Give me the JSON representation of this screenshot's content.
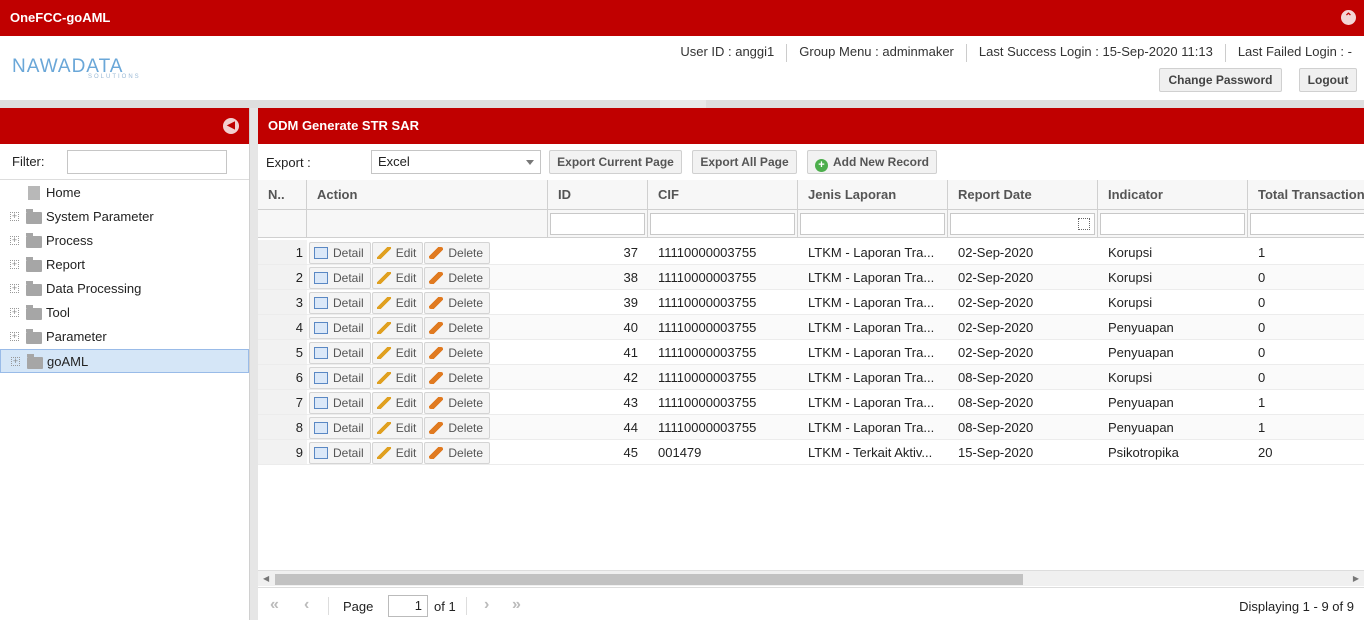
{
  "app": {
    "title": "OneFCC-goAML",
    "collapse_icon": "chevron-up-circle-icon"
  },
  "header": {
    "logo_main": "NAWADATA",
    "logo_sub": "SOLUTIONS",
    "user_id": "User ID : anggi1",
    "group_menu": "Group Menu : adminmaker",
    "last_success": "Last Success Login : 15-Sep-2020 11:13",
    "last_failed": "Last Failed Login : -",
    "change_password": "Change Password",
    "logout": "Logout"
  },
  "sidebar": {
    "filter_label": "Filter:",
    "filter_value": "",
    "items": [
      {
        "label": "Home",
        "type": "leaf"
      },
      {
        "label": "System Parameter",
        "type": "folder"
      },
      {
        "label": "Process",
        "type": "folder"
      },
      {
        "label": "Report",
        "type": "folder"
      },
      {
        "label": "Data Processing",
        "type": "folder"
      },
      {
        "label": "Tool",
        "type": "folder"
      },
      {
        "label": "Parameter",
        "type": "folder"
      },
      {
        "label": "goAML",
        "type": "folder",
        "selected": true
      }
    ]
  },
  "main": {
    "title": "ODM Generate STR SAR",
    "export_label": "Export :",
    "export_value": "Excel",
    "export_current": "Export Current Page",
    "export_all": "Export All Page",
    "add_new": "Add New Record",
    "columns": [
      "N..",
      "Action",
      "ID",
      "CIF",
      "Jenis Laporan",
      "Report Date",
      "Indicator",
      "Total Transaction"
    ],
    "action_labels": {
      "detail": "Detail",
      "edit": "Edit",
      "delete": "Delete"
    },
    "rows": [
      {
        "n": "1",
        "id": "37",
        "cif": "11110000003755",
        "jenis": "LTKM - Laporan Tra...",
        "date": "02-Sep-2020",
        "indicator": "Korupsi",
        "total": "1"
      },
      {
        "n": "2",
        "id": "38",
        "cif": "11110000003755",
        "jenis": "LTKM - Laporan Tra...",
        "date": "02-Sep-2020",
        "indicator": "Korupsi",
        "total": "0"
      },
      {
        "n": "3",
        "id": "39",
        "cif": "11110000003755",
        "jenis": "LTKM - Laporan Tra...",
        "date": "02-Sep-2020",
        "indicator": "Korupsi",
        "total": "0"
      },
      {
        "n": "4",
        "id": "40",
        "cif": "11110000003755",
        "jenis": "LTKM - Laporan Tra...",
        "date": "02-Sep-2020",
        "indicator": "Penyuapan",
        "total": "0"
      },
      {
        "n": "5",
        "id": "41",
        "cif": "11110000003755",
        "jenis": "LTKM - Laporan Tra...",
        "date": "02-Sep-2020",
        "indicator": "Penyuapan",
        "total": "0"
      },
      {
        "n": "6",
        "id": "42",
        "cif": "11110000003755",
        "jenis": "LTKM - Laporan Tra...",
        "date": "08-Sep-2020",
        "indicator": "Korupsi",
        "total": "0"
      },
      {
        "n": "7",
        "id": "43",
        "cif": "11110000003755",
        "jenis": "LTKM - Laporan Tra...",
        "date": "08-Sep-2020",
        "indicator": "Penyuapan",
        "total": "1"
      },
      {
        "n": "8",
        "id": "44",
        "cif": "11110000003755",
        "jenis": "LTKM - Laporan Tra...",
        "date": "08-Sep-2020",
        "indicator": "Penyuapan",
        "total": "1"
      },
      {
        "n": "9",
        "id": "45",
        "cif": "001479",
        "jenis": "LTKM - Terkait Aktiv...",
        "date": "15-Sep-2020",
        "indicator": "Psikotropika",
        "total": "20"
      }
    ]
  },
  "pager": {
    "page_label": "Page",
    "page_value": "1",
    "of_label": "of 1",
    "displaying": "Displaying 1 - 9 of 9"
  },
  "colors": {
    "brand_red": "#c00000",
    "selected_bg": "#d5e6f7"
  }
}
